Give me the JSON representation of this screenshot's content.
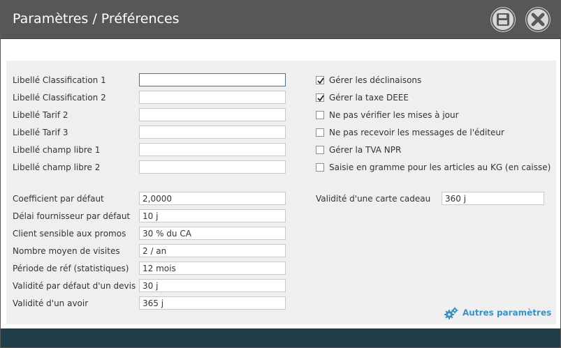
{
  "window": {
    "title": "Paramètres / Préférences"
  },
  "left_fields_top": [
    {
      "label": "Libellé Classification 1",
      "value": ""
    },
    {
      "label": "Libellé Classification 2",
      "value": ""
    },
    {
      "label": "Libellé Tarif 2",
      "value": ""
    },
    {
      "label": "Libellé Tarif 3",
      "value": ""
    },
    {
      "label": "Libellé champ libre 1",
      "value": ""
    },
    {
      "label": "Libellé champ libre 2",
      "value": ""
    }
  ],
  "left_fields_bottom": [
    {
      "label": "Coefficient par défaut",
      "value": "2,0000"
    },
    {
      "label": "Délai fournisseur par défaut",
      "value": "10 j"
    },
    {
      "label": "Client sensible aux promos",
      "value": "30 % du CA"
    },
    {
      "label": "Nombre moyen de visites",
      "value": "2 / an"
    },
    {
      "label": "Période de réf (statistiques)",
      "value": "12 mois"
    },
    {
      "label": "Validité par défaut d'un devis",
      "value": "30 j"
    },
    {
      "label": "Validité d'un avoir",
      "value": "365 j"
    }
  ],
  "checkboxes": [
    {
      "label": "Gérer les déclinaisons",
      "checked": true
    },
    {
      "label": "Gérer la taxe DEEE",
      "checked": true
    },
    {
      "label": "Ne pas vérifier les mises à jour",
      "checked": false
    },
    {
      "label": "Ne pas recevoir les messages de l'éditeur",
      "checked": false
    },
    {
      "label": "Gérer la TVA NPR",
      "checked": false
    },
    {
      "label": "Saisie en gramme pour les articles au KG (en caisse)",
      "checked": false
    }
  ],
  "gift_card": {
    "label": "Validité d'une carte cadeau",
    "value": "360 j"
  },
  "other_params_link": "Autres paramètres",
  "colors": {
    "titlebar": "#575757",
    "panel": "#efefef",
    "footer": "#203d4a",
    "link": "#3a92c4"
  },
  "icons": {
    "save": "floppy-disk-icon",
    "close": "close-icon",
    "settings": "gears-icon"
  }
}
